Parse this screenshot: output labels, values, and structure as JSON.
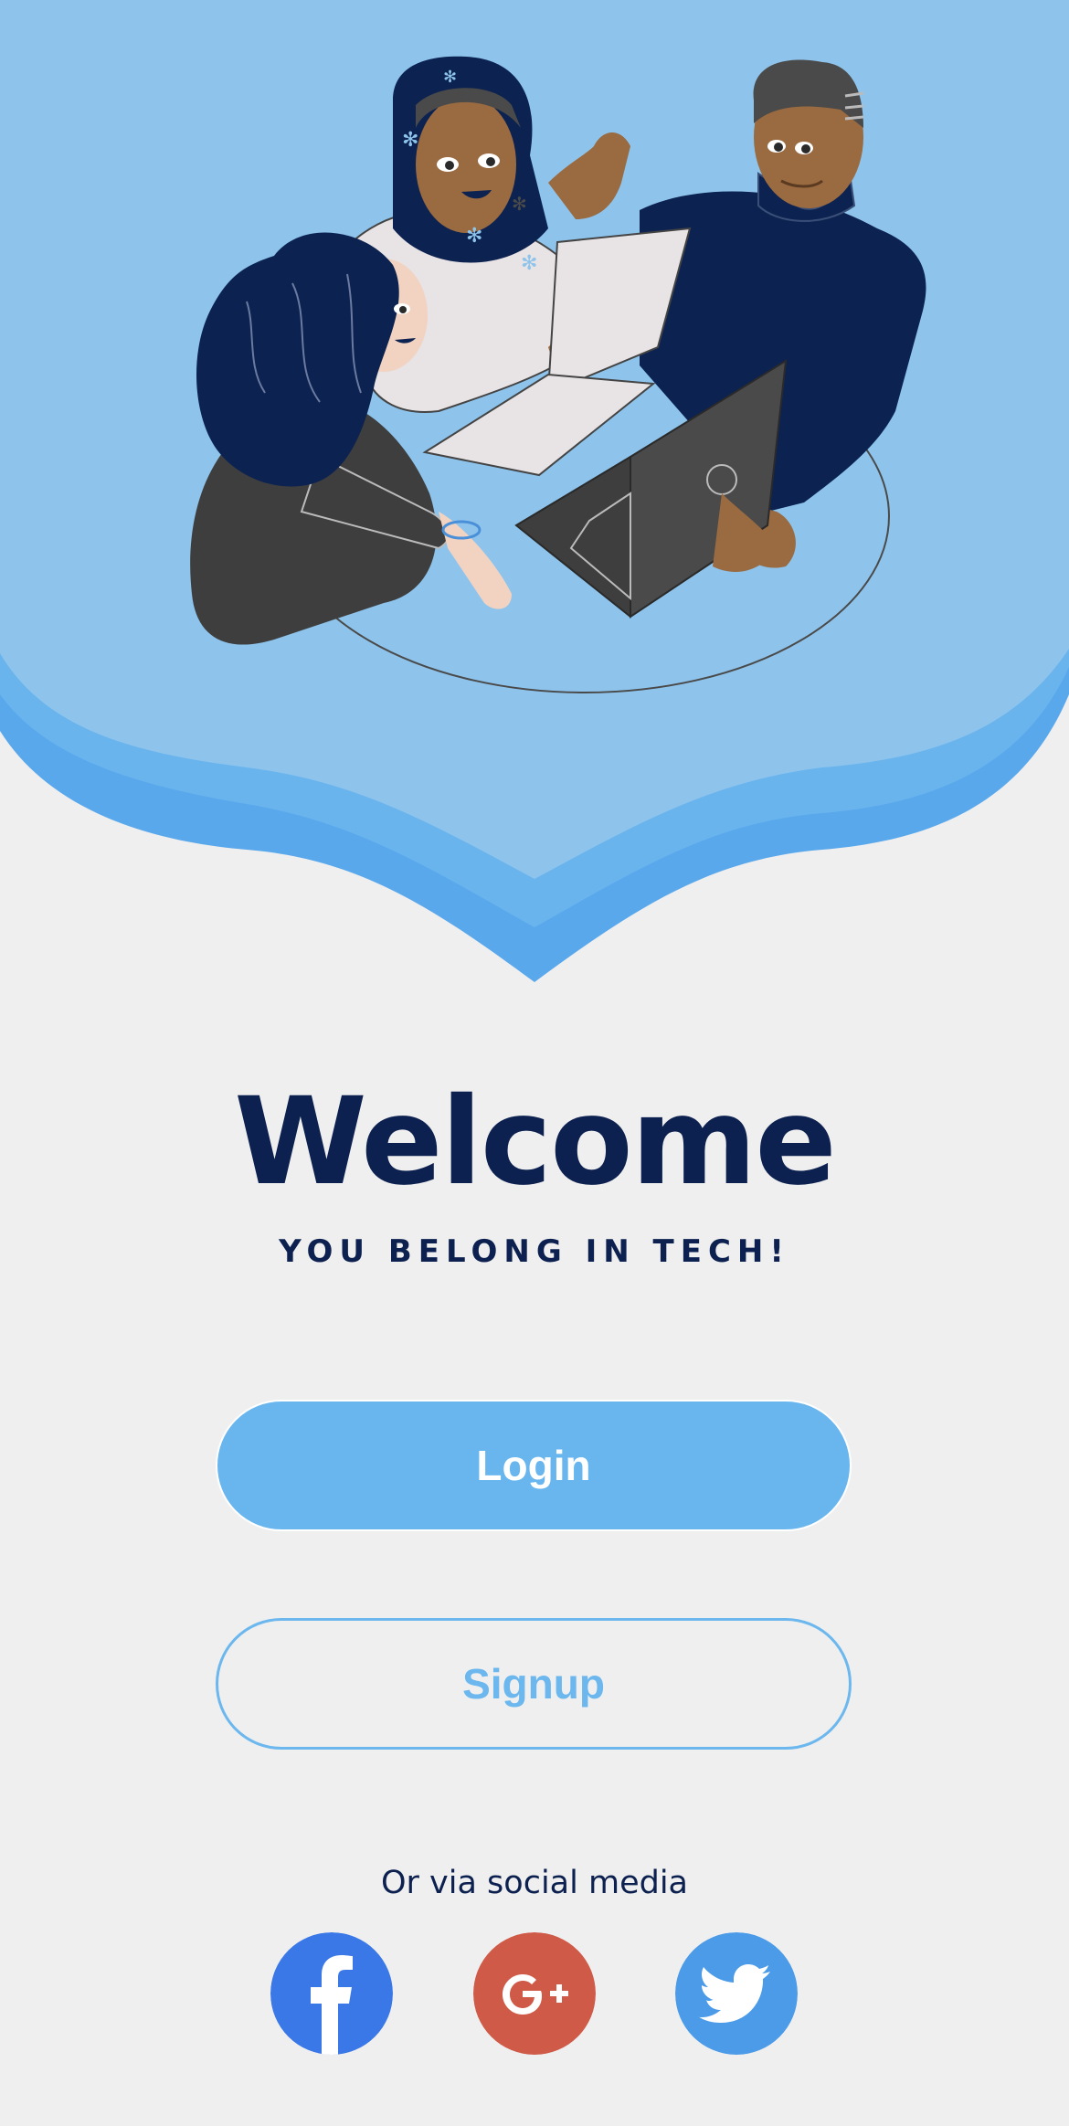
{
  "welcome": {
    "title": "Welcome",
    "tagline": "YOU BELONG IN TECH!"
  },
  "actions": {
    "login_label": "Login",
    "signup_label": "Signup"
  },
  "social": {
    "label": "Or via social media",
    "items": [
      {
        "name": "facebook",
        "icon": "facebook-icon",
        "color": "#3b78e7"
      },
      {
        "name": "google-plus",
        "icon": "google-plus-icon",
        "color": "#cf5a48"
      },
      {
        "name": "twitter",
        "icon": "twitter-icon",
        "color": "#4b9be8"
      }
    ]
  },
  "colors": {
    "hero_light": "#8ec4ec",
    "hero_mid": "#6ab4ee",
    "hero_dark": "#5aa8ec",
    "navy": "#0d2150",
    "background": "#efefef"
  }
}
